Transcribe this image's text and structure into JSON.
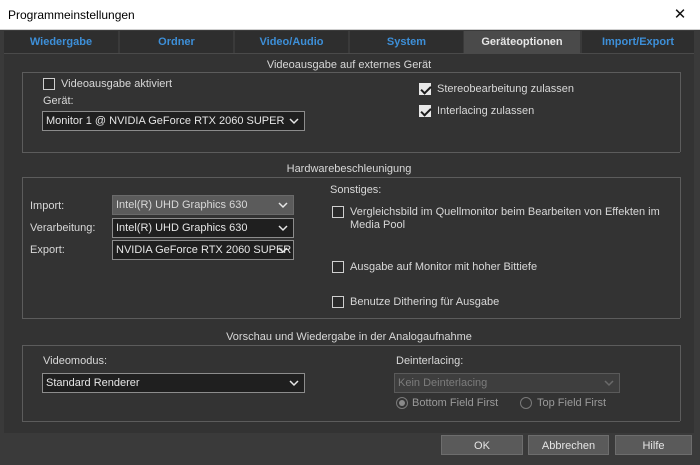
{
  "window": {
    "title": "Programmeinstellungen",
    "close_glyph": "✕"
  },
  "tabs": [
    {
      "label": "Wiedergabe",
      "active": false
    },
    {
      "label": "Ordner",
      "active": false
    },
    {
      "label": "Video/Audio",
      "active": false
    },
    {
      "label": "System",
      "active": false
    },
    {
      "label": "Geräteoptionen",
      "active": true
    },
    {
      "label": "Import/Export",
      "active": false
    }
  ],
  "video_output": {
    "title": "Videoausgabe auf externes Gerät",
    "enable_label": "Videoausgabe aktiviert",
    "enable_checked": false,
    "device_label": "Gerät:",
    "device_value": "Monitor 1 @ NVIDIA GeForce RTX 2060 SUPER",
    "stereo_label": "Stereobearbeitung zulassen",
    "stereo_checked": true,
    "interlacing_label": "Interlacing zulassen",
    "interlacing_checked": true
  },
  "hardware": {
    "title": "Hardwarebeschleunigung",
    "import_label": "Import:",
    "import_value": "Intel(R) UHD Graphics 630",
    "processing_label": "Verarbeitung:",
    "processing_value": "Intel(R) UHD Graphics 630",
    "export_label": "Export:",
    "export_value": "NVIDIA GeForce RTX 2060 SUPER",
    "misc_label": "Sonstiges:",
    "compare_label": "Vergleichsbild im Quellmonitor beim Bearbeiten von Effekten im Media Pool",
    "compare_checked": false,
    "highbit_label": "Ausgabe auf Monitor mit hoher Bittiefe",
    "highbit_checked": false,
    "dither_label": "Benutze Dithering für Ausgabe",
    "dither_checked": false
  },
  "analog": {
    "title": "Vorschau und Wiedergabe in der Analogaufnahme",
    "videomode_label": "Videomodus:",
    "videomode_value": "Standard Renderer",
    "deinterlacing_label": "Deinterlacing:",
    "deinterlacing_value": "Kein Deinterlacing",
    "bottom_label": "Bottom Field First",
    "bottom_checked": true,
    "top_label": "Top Field First",
    "top_checked": false
  },
  "buttons": {
    "ok": "OK",
    "cancel": "Abbrechen",
    "help": "Hilfe"
  },
  "colors": {
    "tab_text": "#3d8fd8",
    "background": "#3a3a3a"
  }
}
